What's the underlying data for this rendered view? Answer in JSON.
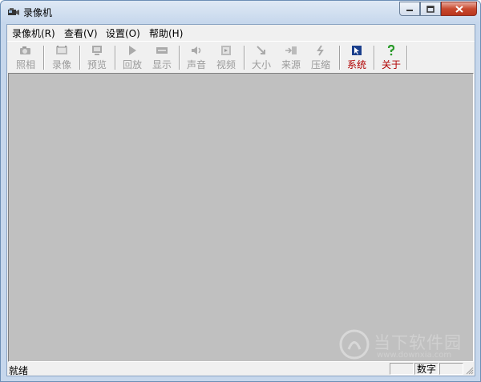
{
  "window": {
    "title": "录像机"
  },
  "menu": [
    {
      "label": "录像机(R)"
    },
    {
      "label": "查看(V)"
    },
    {
      "label": "设置(O)"
    },
    {
      "label": "帮助(H)"
    }
  ],
  "toolbar": [
    {
      "label": "照相",
      "icon": "camera-icon",
      "enabled": false
    },
    {
      "label": "录像",
      "icon": "film-icon",
      "enabled": false
    },
    {
      "label": "预览",
      "icon": "preview-icon",
      "enabled": false
    },
    {
      "label": "回放",
      "icon": "play-icon",
      "enabled": false
    },
    {
      "label": "显示",
      "icon": "display-icon",
      "enabled": false
    },
    {
      "label": "声音",
      "icon": "speaker-icon",
      "enabled": false
    },
    {
      "label": "视频",
      "icon": "video-icon",
      "enabled": false
    },
    {
      "label": "大小",
      "icon": "resize-icon",
      "enabled": false
    },
    {
      "label": "来源",
      "icon": "source-icon",
      "enabled": false
    },
    {
      "label": "压缩",
      "icon": "compress-icon",
      "enabled": false
    },
    {
      "label": "系统",
      "icon": "system-icon",
      "enabled": true
    },
    {
      "label": "关于",
      "icon": "help-icon",
      "enabled": true
    }
  ],
  "status": {
    "left": "就绪",
    "num": "数字"
  },
  "watermark": {
    "text": "当下软件园",
    "url": "www.downxia.com"
  },
  "colors": {
    "video_bg": "#c0c0c0",
    "active_label": "#b00000",
    "disabled_label": "#9a9a9a"
  }
}
